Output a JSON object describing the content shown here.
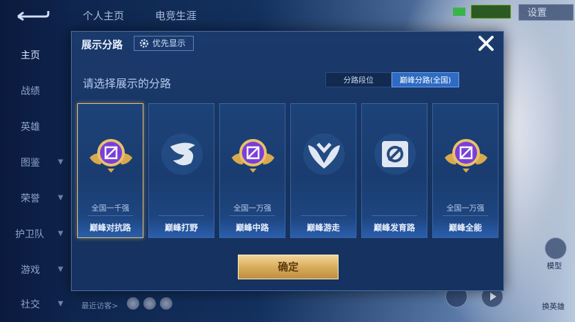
{
  "top_tabs": [
    "个人主页",
    "电竞生涯"
  ],
  "settings_label": "设置",
  "nav": [
    "主页",
    "战绩",
    "英雄",
    "图鉴",
    "荣誉",
    "护卫队",
    "游戏",
    "社交"
  ],
  "recent_visitors_label": "最近访客>",
  "right_labels": {
    "label1": "模型",
    "label2": "换英雄"
  },
  "dialog": {
    "title": "展示分路",
    "priority_label": "优先显示",
    "subtitle": "请选择展示的分路",
    "segments": [
      "分路段位",
      "巅峰分路(全国)"
    ],
    "confirm_label": "确定",
    "cards": [
      {
        "rank": "全国一千强",
        "name": "巅峰对抗路",
        "icon": "crest-purple-gold-icon",
        "selected": true
      },
      {
        "rank": "",
        "name": "巅峰打野",
        "icon": "dragon-gray-icon",
        "selected": false
      },
      {
        "rank": "全国一万强",
        "name": "巅峰中路",
        "icon": "crest-purple-gold-icon",
        "selected": false
      },
      {
        "rank": "",
        "name": "巅峰游走",
        "icon": "wings-gray-icon",
        "selected": false
      },
      {
        "rank": "",
        "name": "巅峰发育路",
        "icon": "bow-gray-icon",
        "selected": false
      },
      {
        "rank": "全国一万强",
        "name": "巅峰全能",
        "icon": "crest-purple-gold-icon",
        "selected": false
      }
    ]
  },
  "colors": {
    "accent_gold": "#e6c479",
    "segment_active": "#2e6bc2",
    "crest_purple": "#7a3fd8"
  }
}
